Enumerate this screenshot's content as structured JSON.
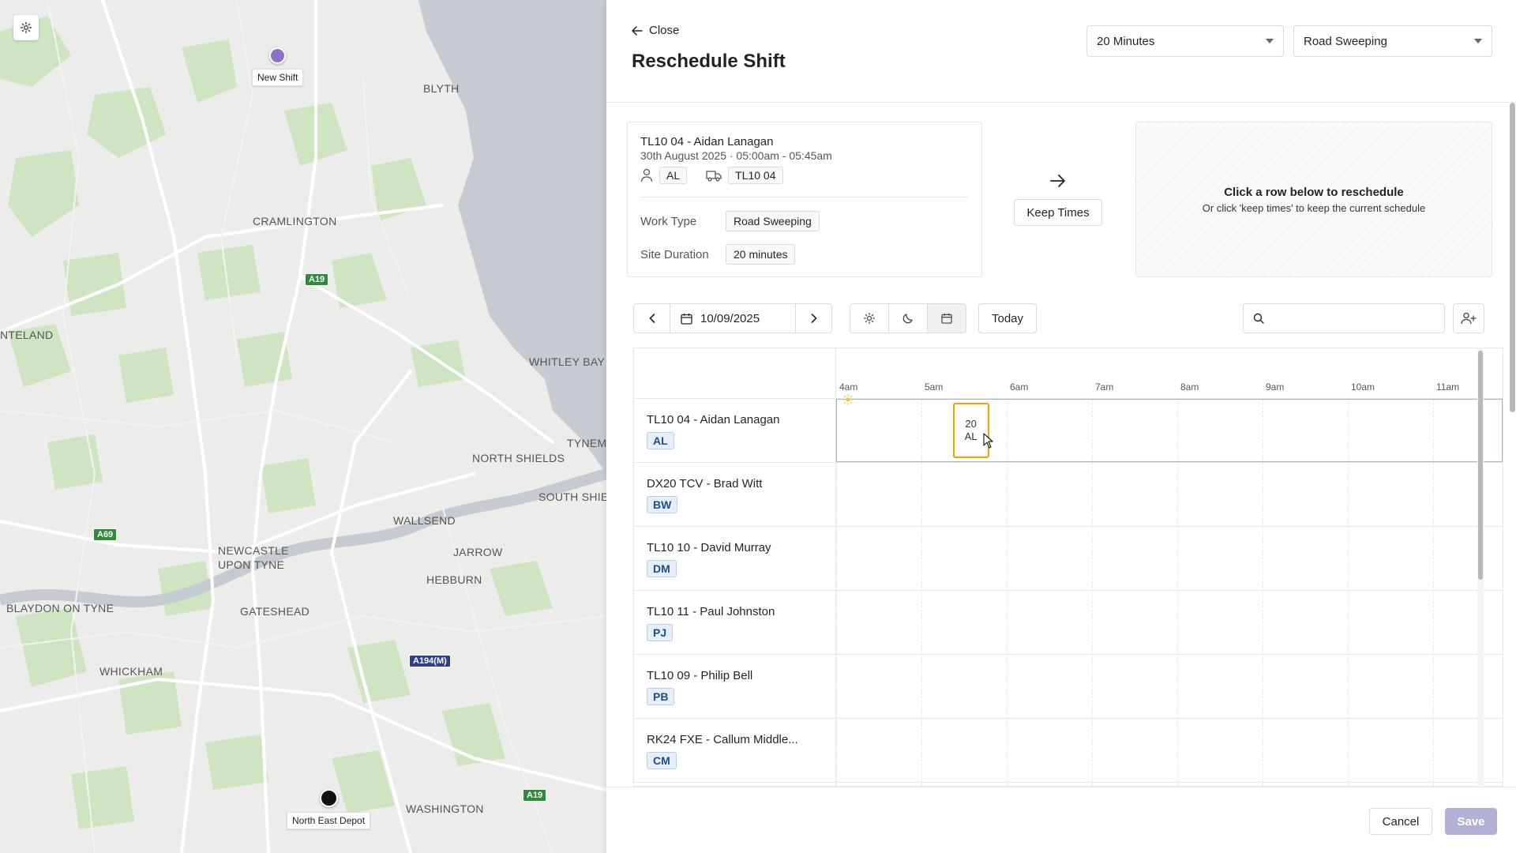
{
  "map": {
    "labels": {
      "blyth": "BLYTH",
      "cramlington": "CRAMLINGTON",
      "whitley_bay": "WHITLEY BAY",
      "nteland": "NTELAND",
      "north_shields": "NORTH SHIELDS",
      "tynemouth": "TYNEMO",
      "south_shields": "SOUTH SHIEL",
      "wallsend": "WALLSEND",
      "newcastle_1": "NEWCASTLE",
      "newcastle_2": "UPON TYNE",
      "jarrow": "JARROW",
      "hebburn": "HEBBURN",
      "blaydon": "BLAYDON ON TYNE",
      "gateshead": "GATESHEAD",
      "whickham": "WHICKHAM",
      "washington": "WASHINGTON"
    },
    "roads": {
      "a19_north": "A19",
      "a69": "A69",
      "a194m": "A194(M)",
      "a19_south": "A19"
    },
    "pins": {
      "new_shift": "New Shift",
      "depot": "North East Depot"
    },
    "colors": {
      "new_shift": "#8e72c8",
      "depot": "#111111"
    },
    "settings_icon": "gear-icon"
  },
  "header": {
    "close_label": "Close",
    "title": "Reschedule Shift",
    "duration_select": "20 Minutes",
    "work_type_select": "Road Sweeping"
  },
  "shift": {
    "title": "TL10 04 - Aidan Lanagan",
    "subtitle": "30th August 2025 · 05:00am - 05:45am",
    "initials": "AL",
    "vehicle": "TL10 04",
    "work_type_label": "Work Type",
    "work_type_value": "Road Sweeping",
    "site_duration_label": "Site Duration",
    "site_duration_value": "20 minutes"
  },
  "keep_times": {
    "label": "Keep Times"
  },
  "hint": {
    "title": "Click a row below to reschedule",
    "subtitle": "Or click 'keep times' to keep the current schedule"
  },
  "toolbar": {
    "date": "10/09/2025",
    "today_label": "Today",
    "search_placeholder": ""
  },
  "schedule": {
    "ticks": [
      "4am",
      "5am",
      "6am",
      "7am",
      "8am",
      "9am",
      "10am",
      "11am"
    ],
    "rows": [
      {
        "name": "TL10 04 - Aidan Lanagan",
        "initials": "AL"
      },
      {
        "name": "DX20 TCV - Brad Witt",
        "initials": "BW"
      },
      {
        "name": "TL10 10 - David Murray",
        "initials": "DM"
      },
      {
        "name": "TL10 11 - Paul Johnston",
        "initials": "PJ"
      },
      {
        "name": "TL10 09 - Philip Bell",
        "initials": "PB"
      },
      {
        "name": "RK24 FXE - Callum Middle...",
        "initials": "CM"
      }
    ],
    "block": {
      "line1": "20",
      "line2": "AL",
      "start_hour": 5.7,
      "color": "#e8a317"
    }
  },
  "footer": {
    "cancel_label": "Cancel",
    "save_label": "Save",
    "save_color": "#b3b0d6"
  }
}
